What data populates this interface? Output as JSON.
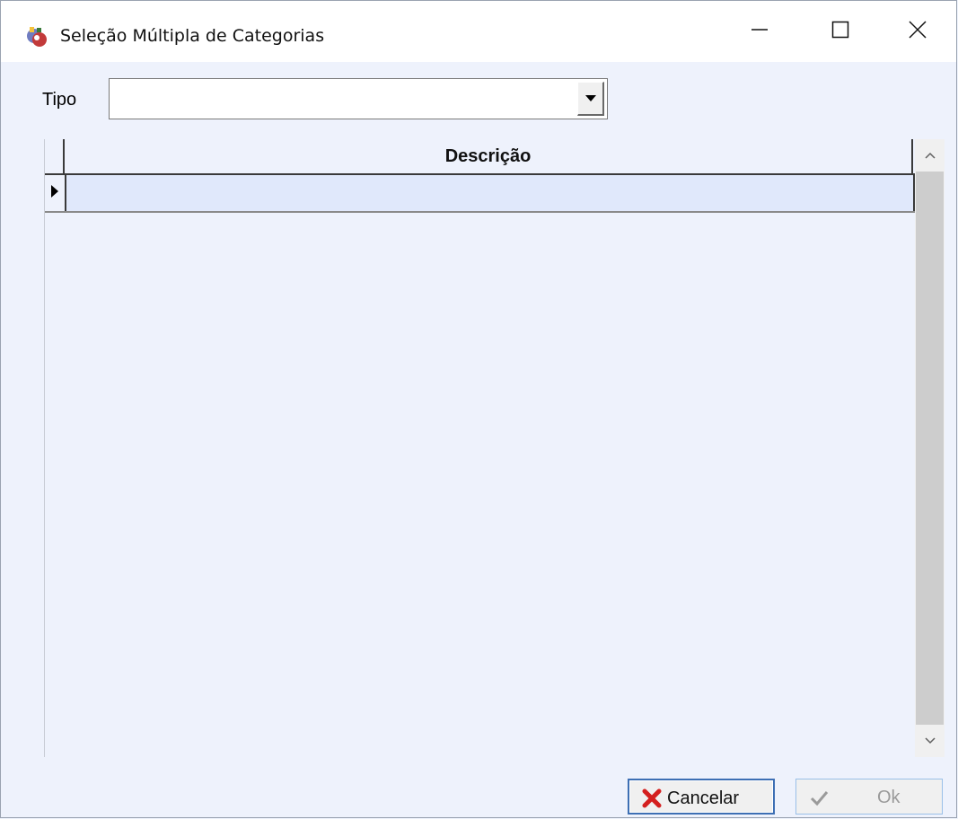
{
  "window": {
    "title": "Seleção Múltipla de Categorias"
  },
  "form": {
    "tipo_label": "Tipo",
    "tipo_value": ""
  },
  "grid": {
    "columns": [
      "Descrição"
    ],
    "rows": [
      ""
    ]
  },
  "buttons": {
    "cancel_label": "Cancelar",
    "ok_label": "Ok"
  },
  "icons": {
    "app": "app-logo-icon",
    "minimize": "minimize-icon",
    "maximize": "maximize-icon",
    "close": "close-icon",
    "dropdown": "dropdown-arrow-icon",
    "row_indicator": "row-pointer-icon",
    "cancel": "red-x-icon",
    "ok": "checkmark-icon"
  },
  "colors": {
    "cancel_icon": "#d41f1f",
    "ok_disabled": "#9a9a9a",
    "selected_row": "#e0e8fb",
    "background": "#eef2fc"
  }
}
